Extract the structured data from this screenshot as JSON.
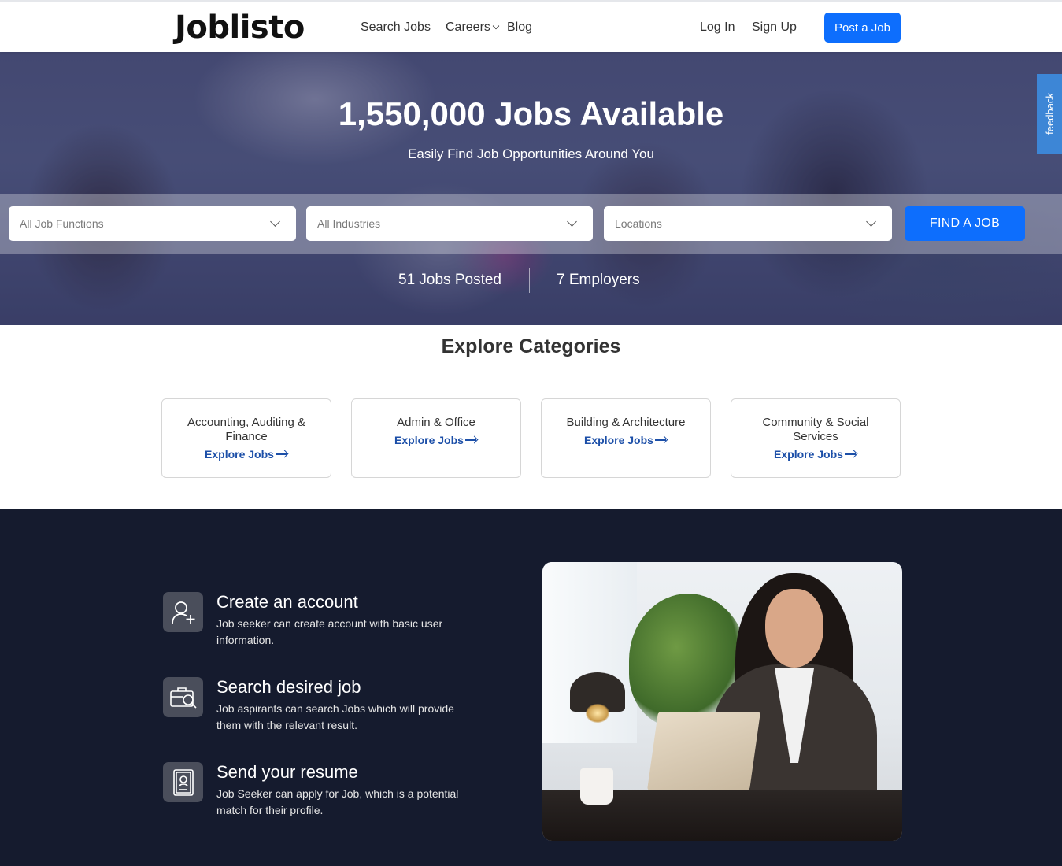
{
  "header": {
    "logo": "Joblisto",
    "nav": {
      "search_jobs": "Search Jobs",
      "careers": "Careers",
      "blog": "Blog",
      "login": "Log In",
      "signup": "Sign Up",
      "post_job": "Post a Job"
    }
  },
  "hero": {
    "title": "1,550,000 Jobs Available",
    "subtitle": "Easily Find Job Opportunities Around You",
    "filters": {
      "job_functions": "All Job Functions",
      "industries": "All Industries",
      "locations": "Locations"
    },
    "find_button": "FIND A JOB",
    "stats": {
      "jobs_posted": "51 Jobs Posted",
      "employers": "7 Employers"
    }
  },
  "feedback_tab": "feedback",
  "categories": {
    "title": "Explore Categories",
    "explore_label": "Explore Jobs",
    "items": [
      {
        "name": "Accounting, Auditing & Finance"
      },
      {
        "name": "Admin & Office"
      },
      {
        "name": "Building & Architecture"
      },
      {
        "name": "Community & Social Services"
      }
    ]
  },
  "steps": [
    {
      "icon": "add-user-icon",
      "title": "Create an account",
      "desc": "Job seeker can create account with basic user information."
    },
    {
      "icon": "briefcase-search-icon",
      "title": "Search desired job",
      "desc": "Job aspirants can search Jobs which will provide them with the relevant result."
    },
    {
      "icon": "resume-icon",
      "title": "Send your resume",
      "desc": "Job Seeker can apply for Job, which is a potential match for their profile."
    }
  ],
  "colors": {
    "primary": "#0d6efd",
    "link": "#1c4fa8",
    "dark_section": "#151b2e",
    "feedback": "#3d86d6"
  }
}
